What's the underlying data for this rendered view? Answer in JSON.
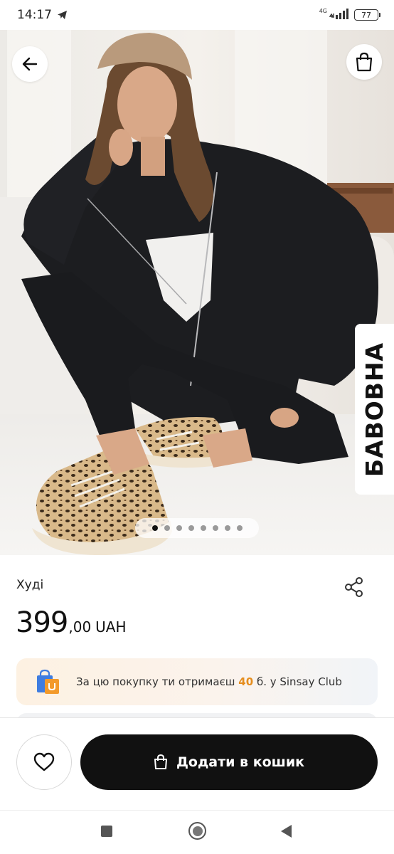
{
  "status_bar": {
    "time": "14:17",
    "network": "4G",
    "battery": "77"
  },
  "hero": {
    "badge_text": "БАВОВНА",
    "image_count": 8,
    "active_image": 1,
    "icons": {
      "back": "arrow-left-icon",
      "cart": "shopping-bag-icon"
    }
  },
  "product": {
    "name": "Худі",
    "price_integer": "399",
    "price_decimal": ",00",
    "currency": "UAH",
    "share_icon": "share-icon"
  },
  "club": {
    "text_before": "За цю покупку ти отримаєш ",
    "points": "40",
    "text_after": " б. у Sinsay Club",
    "points_color": "#e58d1e",
    "icon": "shopping-bag-club-icon"
  },
  "actions": {
    "add_to_cart_label": "Додати в кошик",
    "favorite_icon": "heart-icon",
    "add_icon": "bag-icon",
    "button_color": "#111111"
  },
  "nav": {
    "recents": "square-icon",
    "home": "circle-icon",
    "back": "triangle-back-icon"
  }
}
